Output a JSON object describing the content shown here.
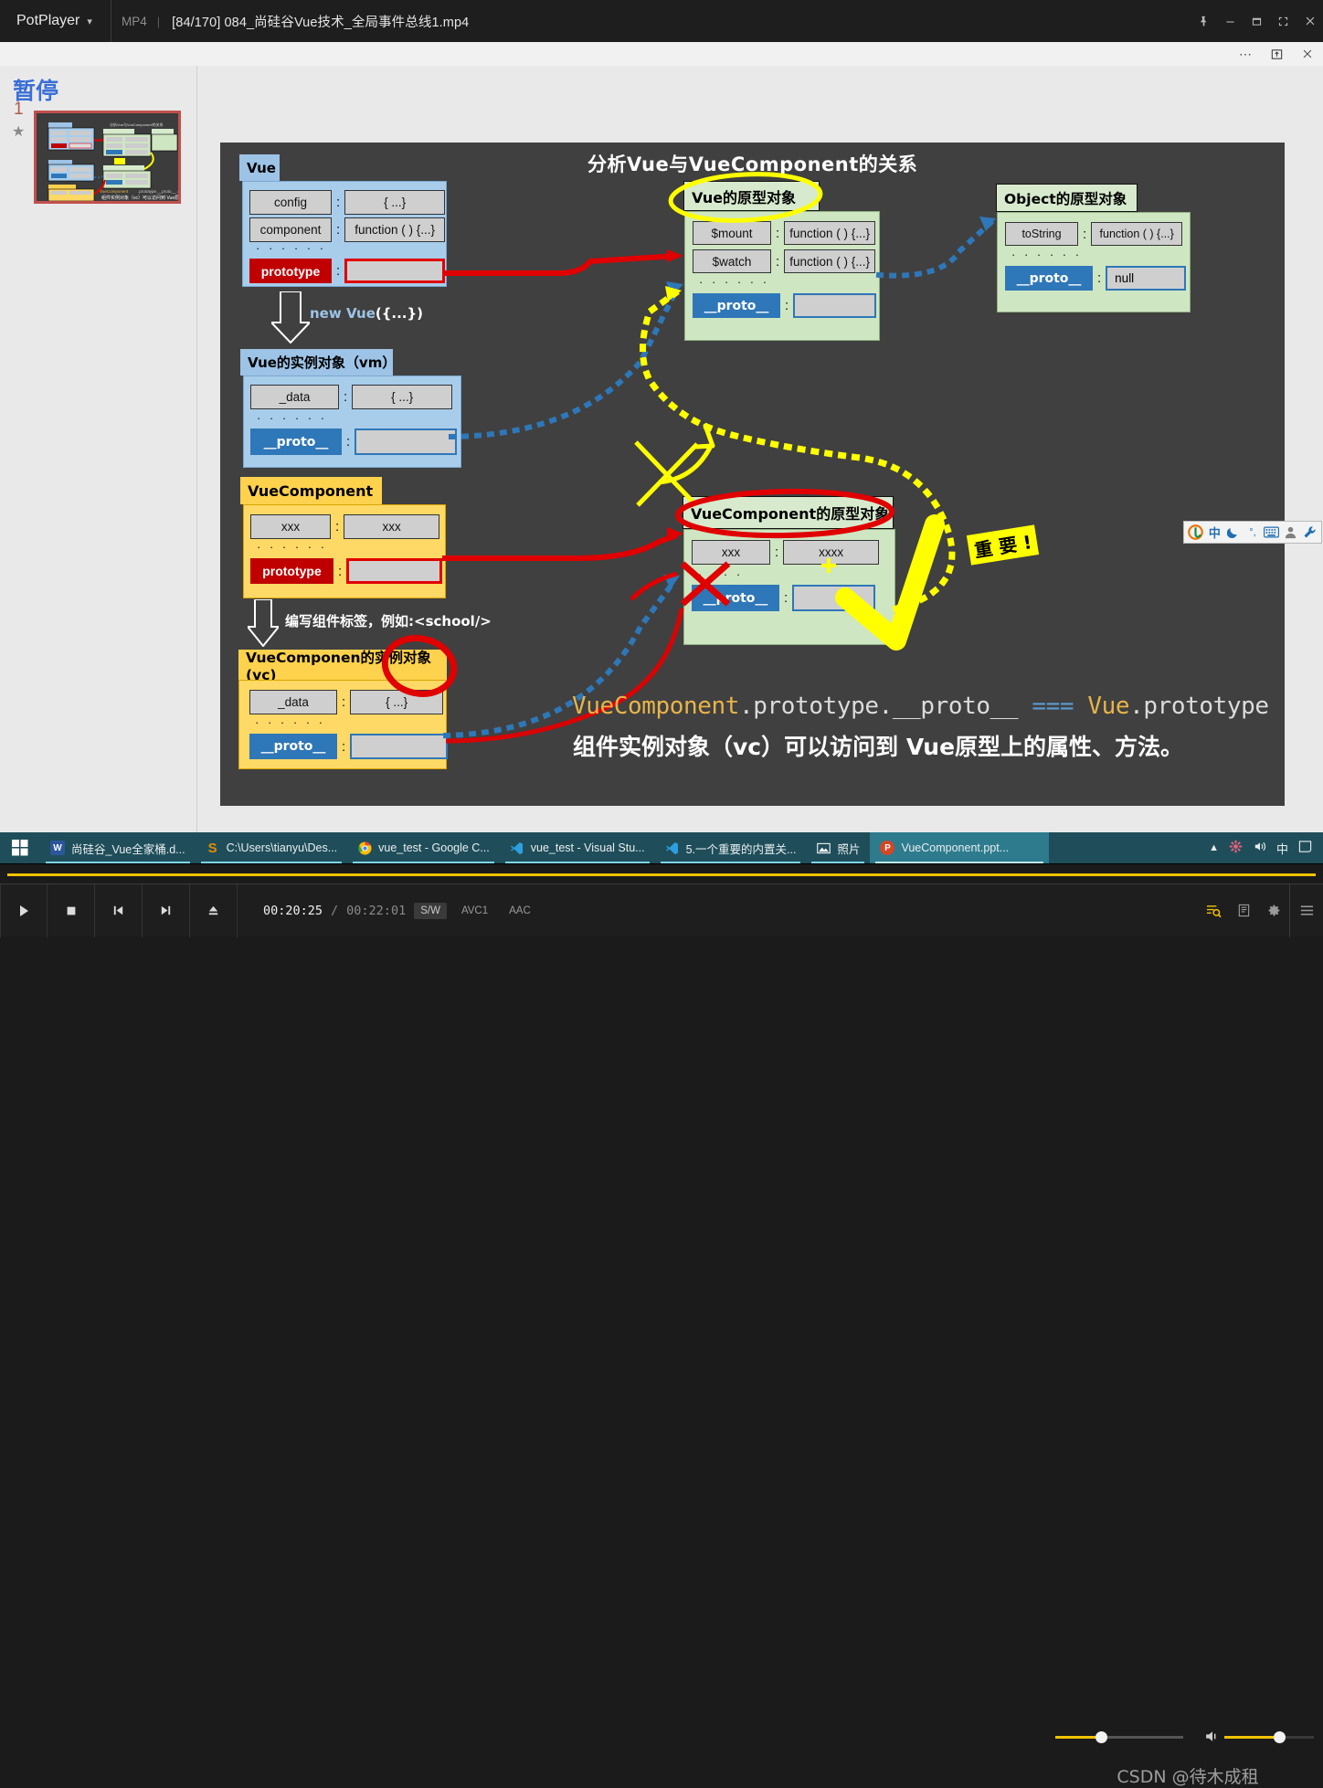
{
  "window": {
    "app_name": "PotPlayer",
    "format": "MP4",
    "separator": "|",
    "title": "[84/170] 084_尚硅谷Vue技术_全局事件总线1.mp4",
    "buttons": [
      "pin-icon",
      "minimize-icon",
      "maximize-icon",
      "fullscreen-icon",
      "close-icon"
    ]
  },
  "ppt": {
    "toolbar": [
      "more-options",
      "restore-window",
      "close-window"
    ],
    "pause_overlay": "暂停",
    "slide_number": "1",
    "star": "★"
  },
  "slide": {
    "title": "分析Vue与VueComponent的关系",
    "vue": {
      "header": "Vue",
      "rows": [
        {
          "key": "config",
          "value": "{ ...}"
        },
        {
          "key": "component",
          "value": "function ( ) {...}"
        }
      ],
      "ellipsis": "· · · · · ·",
      "proto_key": "prototype",
      "proto_value": ""
    },
    "step1": {
      "label_plain_pre": "new ",
      "label_hl": "Vue",
      "label_plain_post": "({...})"
    },
    "vm": {
      "header": "Vue的实例对象（vm）",
      "rows": [
        {
          "key": "_data",
          "value": "{ ...}"
        }
      ],
      "ellipsis": "· · · · · ·",
      "proto_key": "__proto__",
      "proto_value": ""
    },
    "vuecomponent": {
      "header": "VueComponent",
      "rows": [
        {
          "key": "xxx",
          "value": "xxx"
        }
      ],
      "ellipsis": "· · · · · ·",
      "proto_key": "prototype",
      "proto_value": ""
    },
    "step2": {
      "label": "编写组件标签，例如:<school/>"
    },
    "vc": {
      "header": "VueComponen的实例对象(vc)",
      "rows": [
        {
          "key": "_data",
          "value": "{ ...}"
        }
      ],
      "ellipsis": "· · · · · ·",
      "proto_key": "__proto__",
      "proto_value": ""
    },
    "vue_proto": {
      "header": "Vue的原型对象",
      "rows": [
        {
          "key": "$mount",
          "value": "function ( ) {...}"
        },
        {
          "key": "$watch",
          "value": "function ( ) {...}"
        }
      ],
      "ellipsis": "· · · · · ·",
      "proto_key": "__proto__",
      "proto_value": ""
    },
    "object_proto": {
      "header": "Object的原型对象",
      "rows": [
        {
          "key": "toString",
          "value": "function ( ) {...}"
        }
      ],
      "ellipsis": "· · · · · ·",
      "proto_key": "__proto__",
      "proto_value": "null"
    },
    "vc_proto": {
      "header": "VueComponent的原型对象",
      "rows": [
        {
          "key": "xxx",
          "value": "xxxx"
        }
      ],
      "ellipsis": "· · · ·",
      "proto_key": "__proto__",
      "proto_value": ""
    },
    "important_badge": "重 要 !",
    "equation": {
      "part1": "VueComponent",
      "part2": ".prototype.__proto__ ",
      "part3": "=== ",
      "part4": "Vue",
      "part5": ".prototype"
    },
    "conclusion": "组件实例对象（vc）可以访问到 Vue原型上的属性、方法。",
    "colors": {
      "canvas": "#404040",
      "blue_header": "#9dc3e6",
      "blue_body": "#a8cdeb",
      "yellow_header": "#ffd24d",
      "yellow_body": "#ffd966",
      "green_header": "#d7eacd",
      "green_body": "#cfe6c3",
      "proto_blue": "#2e77b8",
      "proto_red": "#c00000",
      "arrow_red": "#e00000",
      "arrow_blue": "#2e77b8",
      "arrow_yellow": "#ffff00"
    }
  },
  "ime": {
    "items": [
      "sogou-logo-icon",
      "chinese-mode-icon",
      "moon-icon",
      "punctuation-icon",
      "keyboard-icon",
      "user-icon",
      "wrench-icon"
    ],
    "mode_label": "中"
  },
  "taskbar": {
    "start": "windows-start-icon",
    "items": [
      {
        "label": "尚硅谷_Vue全家桶.d...",
        "icon": "word-icon",
        "icon_color": "#2b579a",
        "icon_text": "W",
        "active": false
      },
      {
        "label": "C:\\Users\\tianyu\\Des...",
        "icon": "sublime-icon",
        "icon_color": "#e38c00",
        "icon_text": "S",
        "active": false
      },
      {
        "label": "vue_test - Google C...",
        "icon": "chrome-icon",
        "icon_color": "#4285f4",
        "icon_text": "",
        "active": false
      },
      {
        "label": "vue_test - Visual Stu...",
        "icon": "vscode-icon",
        "icon_color": "#2d9fe0",
        "icon_text": "",
        "active": false
      },
      {
        "label": "5.一个重要的内置关...",
        "icon": "vscode-icon",
        "icon_color": "#2d9fe0",
        "icon_text": "",
        "active": false
      },
      {
        "label": "照片",
        "icon": "photos-icon",
        "icon_color": "#ffffff",
        "icon_text": "",
        "active": false
      },
      {
        "label": "VueComponent.ppt...",
        "icon": "powerpoint-icon",
        "icon_color": "#d24726",
        "icon_text": "P",
        "active": true
      }
    ],
    "tray": [
      "chevron-up-icon",
      "antivirus-icon",
      "volume-icon",
      "ime-lang-icon",
      "notifications-icon"
    ],
    "tray_lang": "中"
  },
  "player": {
    "buttons": [
      "play-icon",
      "stop-icon",
      "previous-icon",
      "next-icon",
      "eject-icon"
    ],
    "current_time": "00:20:25",
    "slash": "/",
    "total_time": "00:22:01",
    "tags": [
      "S/W",
      "AVC1",
      "AAC"
    ],
    "right_buttons": [
      "playlist-search-icon",
      "playlist-icon",
      "settings-icon",
      "menu-icon"
    ],
    "seek_percent": 93,
    "speed_percent": 34,
    "volume_percent": 60
  },
  "watermark": "CSDN @待木成租"
}
